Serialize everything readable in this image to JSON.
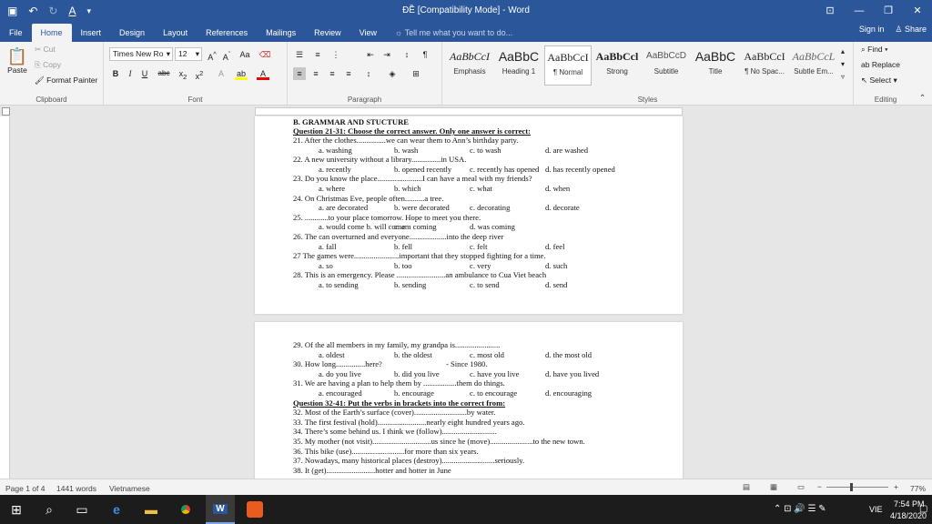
{
  "window": {
    "title": "ĐỀ [Compatibility Mode] - Word"
  },
  "tabs": [
    "File",
    "Home",
    "Insert",
    "Design",
    "Layout",
    "References",
    "Mailings",
    "Review",
    "View"
  ],
  "tell_me": "Tell me what you want to do...",
  "account": {
    "signin": "Sign in",
    "share": "Share"
  },
  "clipboard": {
    "paste": "Paste",
    "cut": "Cut",
    "copy": "Copy",
    "format_painter": "Format Painter",
    "label": "Clipboard"
  },
  "font": {
    "name": "Times New Ro",
    "size": "12",
    "label": "Font"
  },
  "paragraph": {
    "label": "Paragraph"
  },
  "styles": {
    "label": "Styles",
    "items": [
      {
        "preview": "AaBbCcI",
        "name": "Emphasis"
      },
      {
        "preview": "AaBbC",
        "name": "Heading 1"
      },
      {
        "preview": "AaBbCcI",
        "name": "¶ Normal"
      },
      {
        "preview": "AaBbCcl",
        "name": "Strong"
      },
      {
        "preview": "AaBbCcD",
        "name": "Subtitle"
      },
      {
        "preview": "AaBbC",
        "name": "Title"
      },
      {
        "preview": "AaBbCcI",
        "name": "¶ No Spac..."
      },
      {
        "preview": "AaBbCcL",
        "name": "Subtle Em..."
      }
    ]
  },
  "editing": {
    "find": "Find",
    "replace": "Replace",
    "select": "Select",
    "label": "Editing"
  },
  "page1_lines": [
    "B. GRAMMAR AND STUCTURE",
    "Question 21-31: Choose the correct answer. Only one answer is correct:",
    "21. After the clothes...............we can wear them to Ann’s birthday party.",
    "a. washing|b. wash|c. to wash|d. are washed",
    "22. A new university without a library...............in USA.",
    "a. recently|b. opened recently|c. recently has opened|d. has recently opened",
    "23. Do you know the place.......................I can have a meal with my friends?",
    "a. where|b. which|c. what|d. when",
    "24. On Christmas Eve, people often..........a tree.",
    "a. are decorated|b. were decorated|c. decorating|d. decorate",
    "25. ............to your place tomorrow. Hope to meet you there.",
    "a. would come b. will come|c. am coming|d. was coming",
    "26. The can overturned and everyone...................into the deep river",
    "a. fall|b. fell|c. felt|d. feel",
    "27 The games were.......................important that they stopped fighting for a time.",
    "a. so|b. too|c. very|d. such",
    "28. This is an emergency. Please .........................an ambulance to Cua Viet beach",
    "a. to sending|b. sending|c. to send|d. send"
  ],
  "page2_lines": [
    "29. Of the all members in my family, my grandpa is.......................",
    "a. oldest|b. the oldest|c. most old|d. the most old",
    "30. How long...............here?|- Since 1980.",
    "a. do you live|b. did you live|c. have you live|d. have you lived",
    "31. We are having a plan to help them by .................them do things.",
    "a. encouraged|b. encourage|c. to encourage|d. encouraging",
    "Question 32-41: Put the verbs in brackets into the correct from:",
    "32. Most of the Earth’s surface (cover)...........................by water.",
    "33. The first festival (hold).........................nearly eight hundred years ago.",
    "34. There’s some behind us. I think we (follow)............................",
    "35. My mother (not visit)..............................us since he (move)......................to the new town.",
    "36. This bike (use)...........................for more than six years.",
    "37. Nowadays, many historical places (destroy)...........................seriously.",
    "38. It (get).........................hotter and hotter in June"
  ],
  "status": {
    "page": "Page 1 of 4",
    "words": "1441 words",
    "language": "Vietnamese",
    "zoom": "77%"
  },
  "taskbar": {
    "lang": "VIE",
    "time": "7:54 PM",
    "date": "4/18/2020"
  }
}
